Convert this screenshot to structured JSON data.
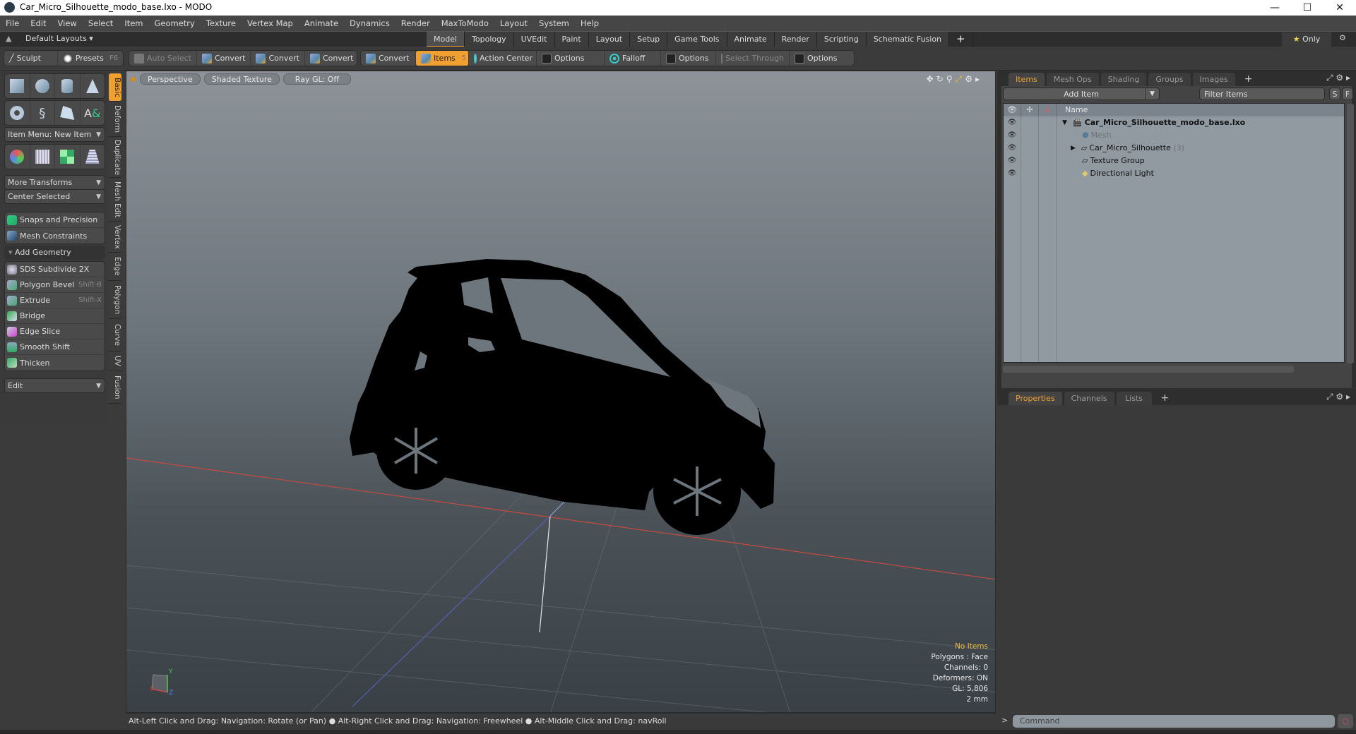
{
  "window": {
    "title": "Car_Micro_Silhouette_modo_base.lxo - MODO",
    "controls": {
      "minimize": "—",
      "maximize": "☐",
      "close": "✕"
    }
  },
  "menu": [
    "File",
    "Edit",
    "View",
    "Select",
    "Item",
    "Geometry",
    "Texture",
    "Vertex Map",
    "Animate",
    "Dynamics",
    "Render",
    "MaxToModo",
    "Layout",
    "System",
    "Help"
  ],
  "layout_bar": {
    "layout_dropdown": "Default Layouts ▾",
    "tabs": [
      "Model",
      "Topology",
      "UVEdit",
      "Paint",
      "Layout",
      "Setup",
      "Game Tools",
      "Animate",
      "Render",
      "Scripting",
      "Schematic Fusion"
    ],
    "active_tab": "Model",
    "plus": "+",
    "only_label": "Only"
  },
  "toolbar": {
    "sculpt": "Sculpt",
    "presets": "Presets",
    "presets_key": "F6",
    "auto_select": "Auto Select",
    "convert": "Convert",
    "items": "Items",
    "items_key": "5",
    "action_center": "Action Center",
    "options": "Options",
    "falloff": "Falloff",
    "select_through": "Select Through"
  },
  "left_panel": {
    "item_menu": "Item Menu: New Item",
    "more_transforms": "More Transforms",
    "center_selected": "Center Selected",
    "snaps": "Snaps and Precision",
    "mesh_constraints": "Mesh Constraints",
    "add_geometry": "Add Geometry",
    "tools": [
      {
        "label": "SDS Subdivide 2X",
        "shortcut": ""
      },
      {
        "label": "Polygon Bevel",
        "shortcut": "Shift-B"
      },
      {
        "label": "Extrude",
        "shortcut": "Shift-X"
      },
      {
        "label": "Bridge",
        "shortcut": ""
      },
      {
        "label": "Edge Slice",
        "shortcut": ""
      },
      {
        "label": "Smooth Shift",
        "shortcut": ""
      },
      {
        "label": "Thicken",
        "shortcut": ""
      }
    ],
    "edit": "Edit",
    "vertical_tabs": [
      "Basic",
      "Deform",
      "Duplicate",
      "Mesh Edit",
      "Vertex",
      "Edge",
      "Polygon",
      "Curve",
      "UV",
      "Fusion"
    ]
  },
  "viewport": {
    "view": "Perspective",
    "shading": "Shaded Texture",
    "raygl": "Ray GL: Off",
    "stats": {
      "selection": "No Items",
      "polygons": "Polygons : Face",
      "channels": "Channels: 0",
      "deformers": "Deformers: ON",
      "gl": "GL: 5,806",
      "unit": "2 mm"
    },
    "axis": {
      "x": "X",
      "y": "Y",
      "z": "Z"
    }
  },
  "items_panel": {
    "tabs": [
      "Items",
      "Mesh Ops",
      "Shading",
      "Groups",
      "Images"
    ],
    "add_item": "Add Item",
    "filter_placeholder": "Filter Items",
    "s": "S",
    "f": "F",
    "column_name": "Name",
    "rows": [
      {
        "name": "Car_Micro_Silhouette_modo_base.lxo",
        "count": ""
      },
      {
        "name": "Mesh",
        "count": ""
      },
      {
        "name": "Car_Micro_Silhouette",
        "count": "(3)"
      },
      {
        "name": "Texture Group",
        "count": ""
      },
      {
        "name": "Directional Light",
        "count": ""
      }
    ]
  },
  "properties_panel": {
    "tabs": [
      "Properties",
      "Channels",
      "Lists"
    ]
  },
  "status": {
    "text": "Alt-Left Click and Drag: Navigation: Rotate (or Pan) ● Alt-Right Click and Drag: Navigation: Freewheel ● Alt-Middle Click and Drag: navRoll"
  },
  "command": {
    "placeholder": "Command",
    "prompt": ">"
  }
}
